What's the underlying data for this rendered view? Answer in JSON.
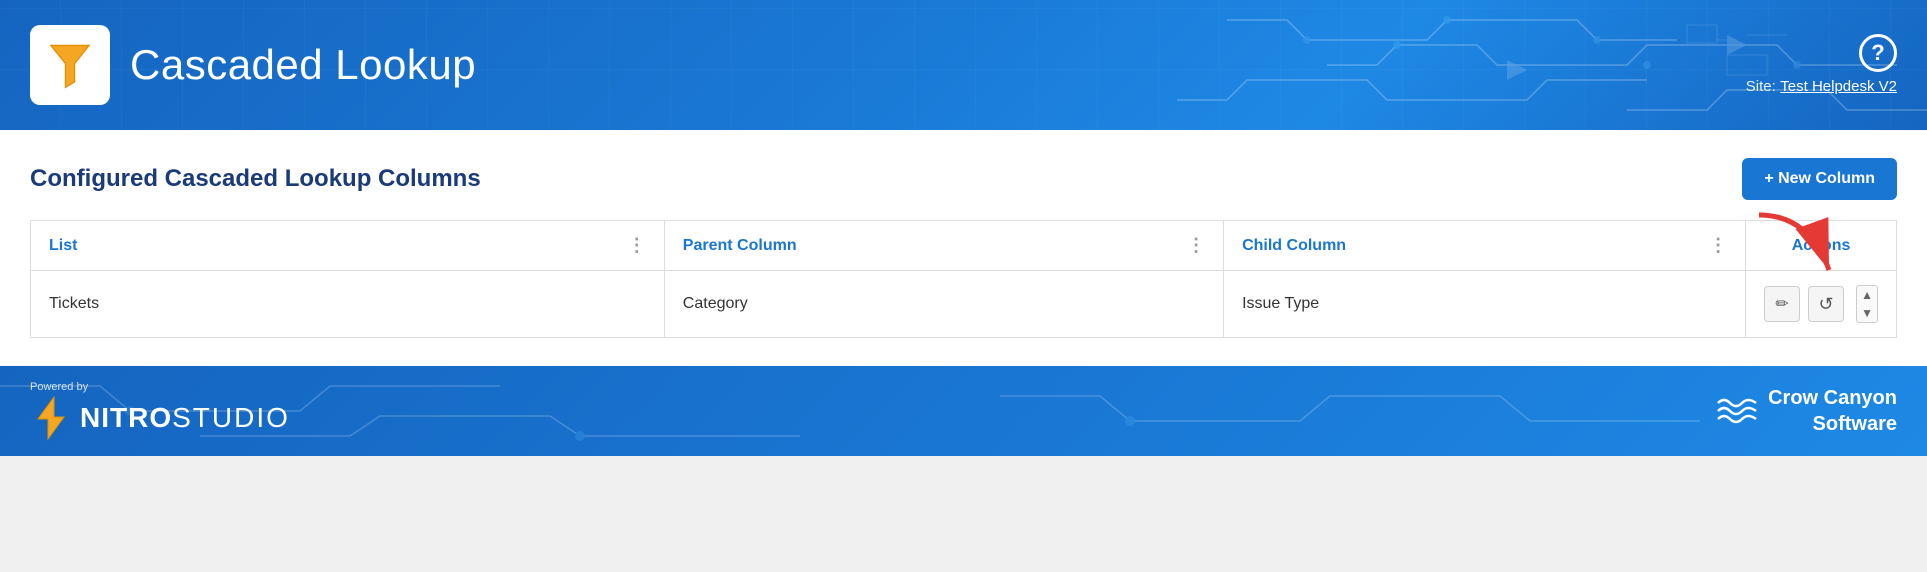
{
  "header": {
    "title": "Cascaded Lookup",
    "site_label": "Site:",
    "site_name": "Test Helpdesk V2",
    "help_icon": "?"
  },
  "main": {
    "section_title": "Configured Cascaded Lookup Columns",
    "new_column_btn": "+ New Column",
    "table": {
      "columns": [
        {
          "label": "List",
          "key": "list"
        },
        {
          "label": "Parent Column",
          "key": "parent_column"
        },
        {
          "label": "Child Column",
          "key": "child_column"
        },
        {
          "label": "Actions",
          "key": "actions"
        }
      ],
      "rows": [
        {
          "list": "Tickets",
          "parent_column": "Category",
          "child_column": "Issue Type",
          "actions": [
            "edit",
            "refresh"
          ]
        }
      ]
    }
  },
  "footer": {
    "powered_by": "Powered by",
    "nitro": "NITRO",
    "studio": " STUDIO",
    "company": "Crow Canyon",
    "software": "Software"
  },
  "icons": {
    "funnel": "funnel-icon",
    "help": "help-icon",
    "plus": "+",
    "edit": "✏",
    "refresh": "↺",
    "scroll_up": "▲",
    "scroll_down": "▼",
    "col_menu": "⋮"
  }
}
